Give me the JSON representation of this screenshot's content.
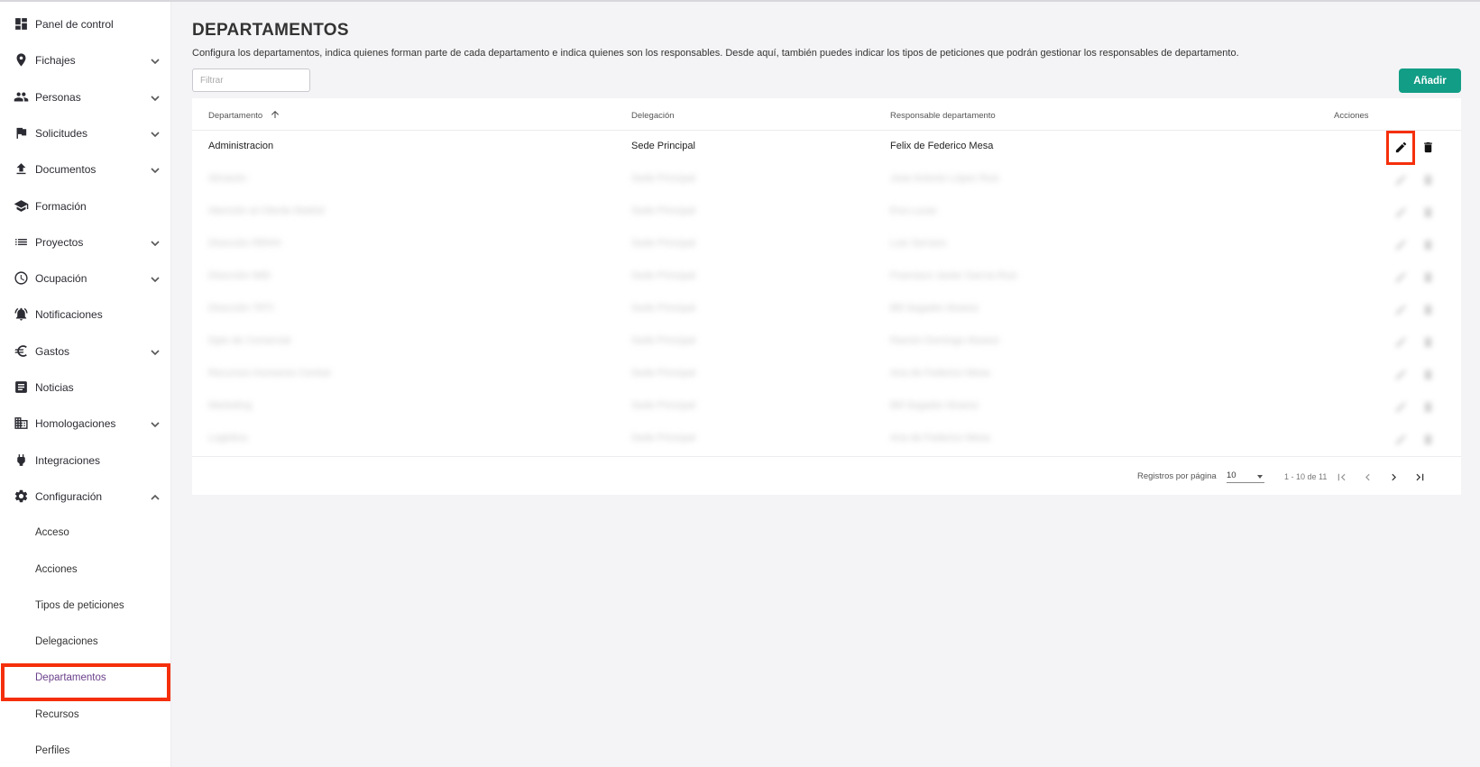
{
  "sidebar": {
    "items": [
      {
        "label": "Panel de control",
        "icon": "dashboard-icon",
        "chevron": false
      },
      {
        "label": "Fichajes",
        "icon": "location-pin-icon",
        "chevron": true
      },
      {
        "label": "Personas",
        "icon": "people-icon",
        "chevron": true
      },
      {
        "label": "Solicitudes",
        "icon": "flag-icon",
        "chevron": true
      },
      {
        "label": "Documentos",
        "icon": "upload-icon",
        "chevron": true
      },
      {
        "label": "Formación",
        "icon": "graduation-cap-icon",
        "chevron": false
      },
      {
        "label": "Proyectos",
        "icon": "list-icon",
        "chevron": true
      },
      {
        "label": "Ocupación",
        "icon": "clock-icon",
        "chevron": true
      },
      {
        "label": "Notificaciones",
        "icon": "bell-icon",
        "chevron": false
      },
      {
        "label": "Gastos",
        "icon": "euro-icon",
        "chevron": true
      },
      {
        "label": "Noticias",
        "icon": "news-icon",
        "chevron": false
      },
      {
        "label": "Homologaciones",
        "icon": "building-icon",
        "chevron": true
      },
      {
        "label": "Integraciones",
        "icon": "plug-icon",
        "chevron": false
      },
      {
        "label": "Configuración",
        "icon": "gear-icon",
        "chevron": true,
        "expanded": true
      }
    ],
    "subitems": [
      {
        "label": "Acceso"
      },
      {
        "label": "Acciones"
      },
      {
        "label": "Tipos de peticiones"
      },
      {
        "label": "Delegaciones"
      },
      {
        "label": "Departamentos",
        "active": true
      },
      {
        "label": "Recursos"
      },
      {
        "label": "Perfiles"
      }
    ]
  },
  "main": {
    "title": "DEPARTAMENTOS",
    "description": "Configura los departamentos, indica quienes forman parte de cada departamento e indica quienes son los responsables. Desde aquí, también puedes indicar los tipos de peticiones que podrán gestionar los responsables de departamento.",
    "filter_placeholder": "Filtrar",
    "add_label": "Añadir"
  },
  "table": {
    "columns": [
      "Departamento",
      "Delegación",
      "Responsable departamento",
      "Acciones"
    ],
    "sort": "Departamento ascending",
    "rows": [
      [
        "Administracion",
        "Sede Principal",
        "Felix de Federico Mesa"
      ],
      [
        "Almacén",
        "Sede Principal",
        "Jose Antonio López Ruiz"
      ],
      [
        "Atención al Cliente Madrid",
        "Sede Principal",
        "Eva Lucas"
      ],
      [
        "Dirección RRHH",
        "Sede Principal",
        "Luis Serrano"
      ],
      [
        "Dirección IMD",
        "Sede Principal",
        "Francisco Javier García Ruiz"
      ],
      [
        "Dirección TRTI",
        "Sede Principal",
        "Bill Segador Alvarez"
      ],
      [
        "Dpto de Comercial",
        "Sede Principal",
        "Ramón Domingo Alvarez"
      ],
      [
        "Recursos Humanos Central",
        "Sede Principal",
        "Ana de Federico Mesa"
      ],
      [
        "Marketing",
        "Sede Principal",
        "Bill Segador Alvarez"
      ],
      [
        "Logistica",
        "Sede Principal",
        "Ana de Federico Mesa"
      ]
    ]
  },
  "pagination": {
    "per_page_label": "Registros por página",
    "per_page_value": "10",
    "range": "1 - 10 de 11"
  },
  "colors": {
    "accent": "#129d86",
    "highlight": "#f52f0b",
    "active_text": "#6a3f8a"
  }
}
